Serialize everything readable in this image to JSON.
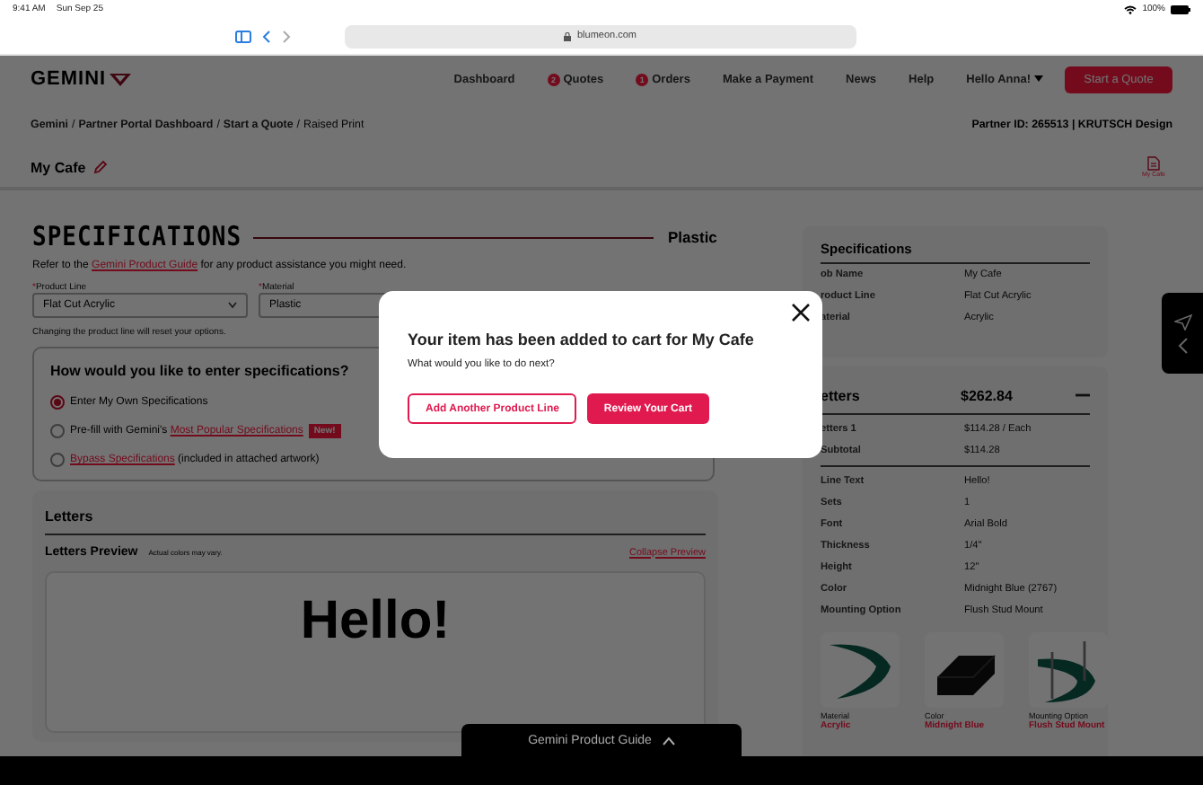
{
  "status_bar": {
    "time": "9:41 AM",
    "date": "Sun Sep 25",
    "battery": "100%"
  },
  "browser": {
    "url": "blumeon.com"
  },
  "header": {
    "logo": "GEMINI",
    "nav": [
      {
        "label": "Dashboard"
      },
      {
        "label": "Quotes",
        "badge": "2"
      },
      {
        "label": "Orders",
        "badge": "1"
      },
      {
        "label": "Make a Payment"
      },
      {
        "label": "News"
      },
      {
        "label": "Help"
      },
      {
        "label": "Hello Anna!",
        "dropdown": true
      }
    ],
    "cta": "Start a Quote"
  },
  "breadcrumb_separator": "/",
  "breadcrumb": [
    {
      "label": "Gemini",
      "current": false
    },
    {
      "label": "Partner Portal Dashboard",
      "current": false
    },
    {
      "label": "Start a Quote",
      "current": false
    },
    {
      "label": "Raised Print",
      "current": true
    }
  ],
  "partner": {
    "label": "Partner ID:",
    "id": "265513",
    "separator": "|",
    "company": "KRUTSCH Design"
  },
  "job": {
    "title": "My Cafe",
    "file_label": "My Cafe"
  },
  "specifications": {
    "heading": "SPECIFICATIONS",
    "material_tag": "Plastic",
    "intro_before": "Refer to the ",
    "intro_link": "Gemini Product Guide",
    "intro_after": " for any product assistance you might need.",
    "fields": [
      {
        "required_mark": "*",
        "label": "Product Line",
        "value": "Flat Cut Acrylic"
      },
      {
        "required_mark": "*",
        "label": "Material",
        "value": "Plastic"
      }
    ],
    "hint": "Changing the product line will reset your options.",
    "entry": {
      "question": "How would you like to enter specifications?",
      "options": [
        {
          "before": "Enter My Own Specifications",
          "selected": true
        },
        {
          "before": "Pre-fill with Gemini's ",
          "link": "Most Popular Specifications",
          "badge": "New!",
          "selected": false
        },
        {
          "link": "Bypass Specifications",
          "after": " (included in attached artwork)",
          "selected": false
        }
      ]
    }
  },
  "letters": {
    "title": "Letters",
    "preview_title": "Letters Preview",
    "preview_note": "Actual colors may vary.",
    "collapse": "Collapse Preview",
    "preview_text": "Hello!"
  },
  "summary": {
    "title": "Specifications",
    "rows": [
      {
        "label": "ob Name",
        "value": "My Cafe"
      },
      {
        "label": "roduct Line",
        "value": "Flat Cut Acrylic"
      },
      {
        "label": "aterial",
        "value": "Acrylic"
      }
    ]
  },
  "letters_card": {
    "title": "etters",
    "total": "$262.84",
    "expanded": true,
    "price_rows": [
      {
        "label": "etters 1",
        "value": "$114.28 / Each"
      },
      {
        "label": "Subtotal",
        "value": "$114.28"
      }
    ],
    "detail_rows": [
      {
        "label": "Line Text",
        "value": "Hello!"
      },
      {
        "label": "Sets",
        "value": "1"
      },
      {
        "label": "Font",
        "value": "Arial Bold"
      },
      {
        "label": "Thickness",
        "value": "1/4\""
      },
      {
        "label": "Height",
        "value": "12\""
      },
      {
        "label": "Color",
        "value": "Midnight Blue (2767)"
      },
      {
        "label": "Mounting Option",
        "value": "Flush Stud Mount"
      }
    ],
    "thumbnails": [
      {
        "caption": "Material",
        "value": "Acrylic",
        "kind": "curve"
      },
      {
        "caption": "Color",
        "value": "Midnight Blue",
        "kind": "block"
      },
      {
        "caption": "Mounting Option",
        "value": "Flush Stud Mount",
        "kind": "stud"
      }
    ]
  },
  "modal": {
    "title": "Your item has been added to cart for My Cafe",
    "message": "What would you like to do next?",
    "buttons": [
      {
        "label": "Add Another Product Line",
        "kind": "outline"
      },
      {
        "label": "Review Your Cart",
        "kind": "primary"
      }
    ]
  },
  "guide_tab": {
    "label": "Gemini Product Guide"
  }
}
